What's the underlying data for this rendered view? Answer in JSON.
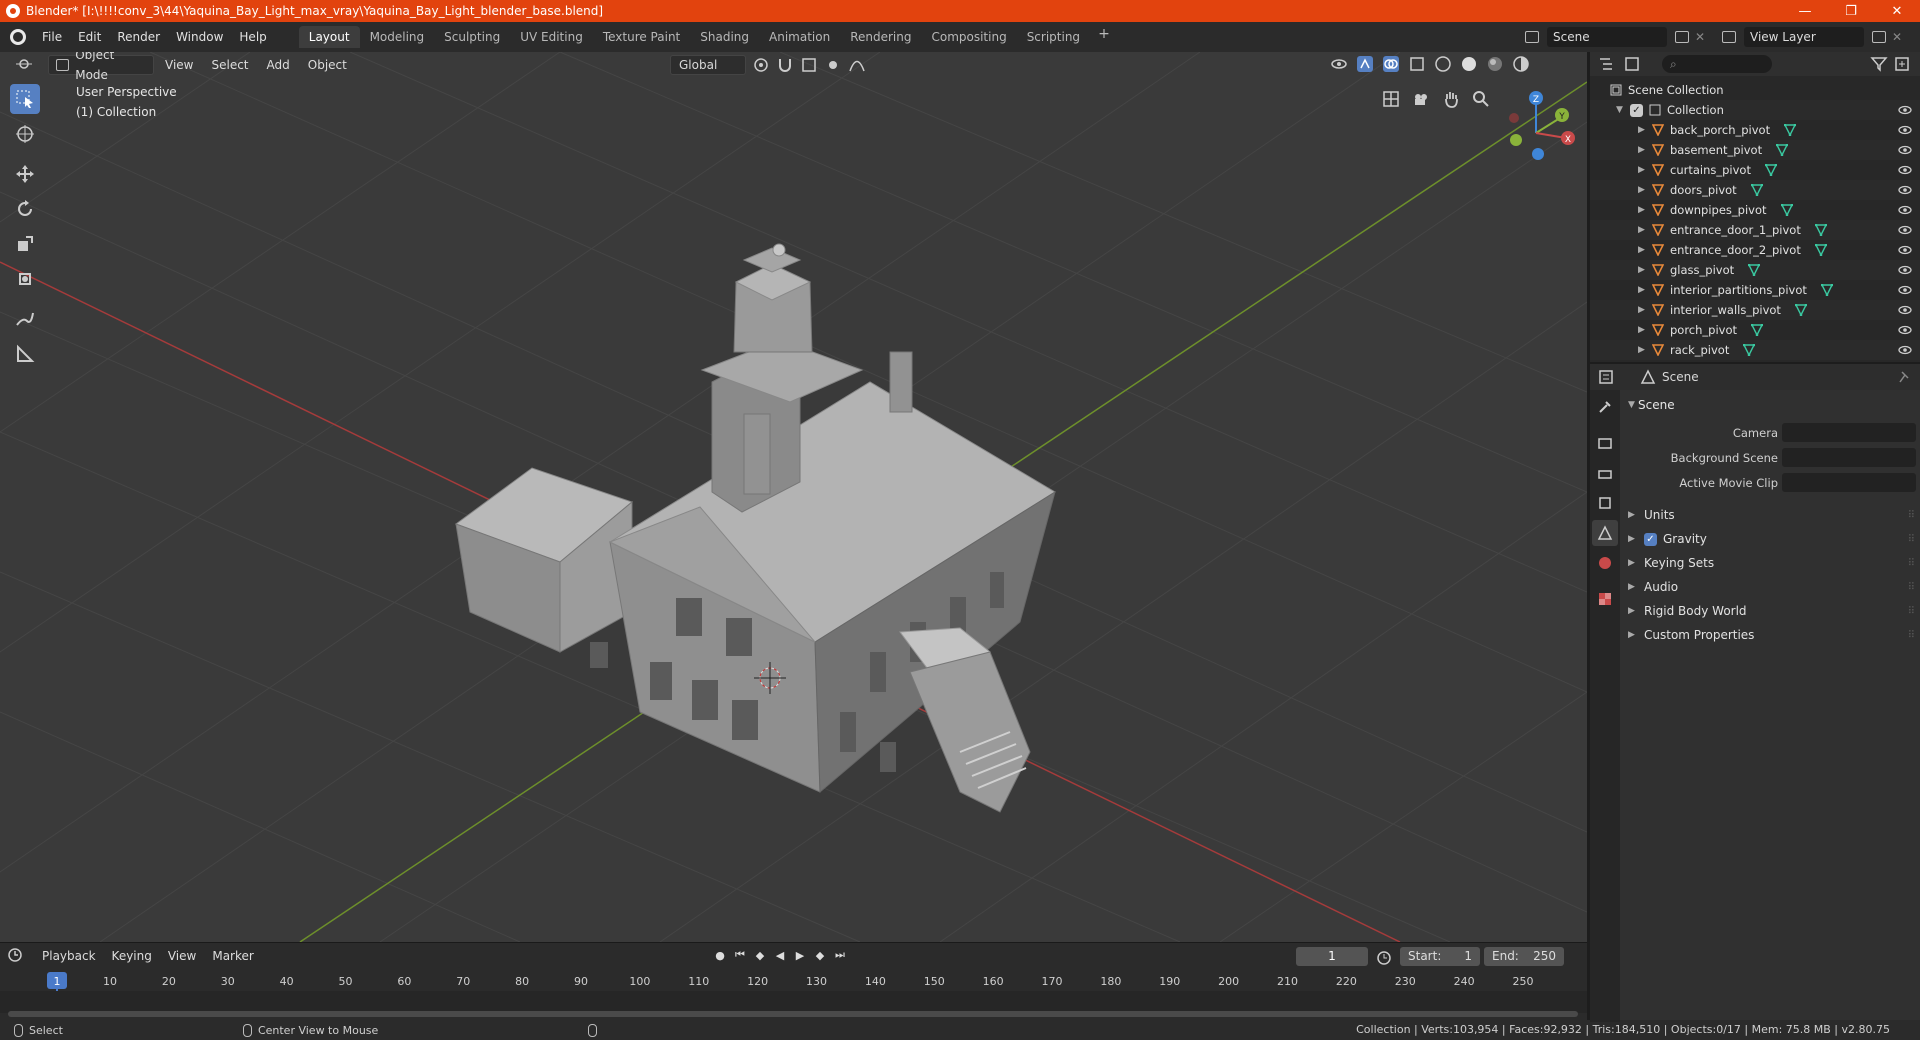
{
  "window": {
    "title": "Blender* [I:\\!!!!conv_3\\44\\Yaquina_Bay_Light_max_vray\\Yaquina_Bay_Light_blender_base.blend]",
    "minimize": "—",
    "maximize": "❐",
    "close": "✕"
  },
  "menu": [
    "File",
    "Edit",
    "Render",
    "Window",
    "Help"
  ],
  "workspaces": [
    "Layout",
    "Modeling",
    "Sculpting",
    "UV Editing",
    "Texture Paint",
    "Shading",
    "Animation",
    "Rendering",
    "Compositing",
    "Scripting"
  ],
  "workspace_add": "+",
  "scene_selector": "Scene",
  "view_layer_selector": "View Layer",
  "viewport": {
    "mode": "Object Mode",
    "menus": [
      "View",
      "Select",
      "Add",
      "Object"
    ],
    "orientation": "Global",
    "overlay_line1": "User Perspective",
    "overlay_line2": "(1) Collection",
    "gizmo": {
      "x": "X",
      "y": "Y",
      "z": "Z"
    }
  },
  "timeline": {
    "menus": [
      "Playback",
      "Keying",
      "View",
      "Marker"
    ],
    "current_frame": "1",
    "start_label": "Start:",
    "start": "1",
    "end_label": "End:",
    "end": "250",
    "ticks": [
      "1",
      "10",
      "20",
      "30",
      "40",
      "50",
      "60",
      "70",
      "80",
      "90",
      "100",
      "110",
      "120",
      "130",
      "140",
      "150",
      "160",
      "170",
      "180",
      "190",
      "200",
      "210",
      "220",
      "230",
      "240",
      "250"
    ]
  },
  "statusbar": {
    "select": "Select",
    "center_view": "Center View to Mouse",
    "stats": "Collection | Verts:103,954 | Faces:92,932 | Tris:184,510 | Objects:0/17 | Mem: 75.8 MB | v2.80.75"
  },
  "outliner": {
    "scene_collection": "Scene Collection",
    "collection": "Collection",
    "items": [
      "back_porch_pivot",
      "basement_pivot",
      "curtains_pivot",
      "doors_pivot",
      "downpipes_pivot",
      "entrance_door_1_pivot",
      "entrance_door_2_pivot",
      "glass_pivot",
      "interior_partitions_pivot",
      "interior_walls_pivot",
      "porch_pivot",
      "rack_pivot"
    ]
  },
  "properties": {
    "header": "Scene",
    "panel": "Scene",
    "fields": [
      {
        "label": "Camera"
      },
      {
        "label": "Background Scene"
      },
      {
        "label": "Active Movie Clip"
      }
    ],
    "subpanels": [
      {
        "label": "Units",
        "checkbox": false
      },
      {
        "label": "Gravity",
        "checkbox": true
      },
      {
        "label": "Keying Sets",
        "checkbox": false
      },
      {
        "label": "Audio",
        "checkbox": false
      },
      {
        "label": "Rigid Body World",
        "checkbox": false
      },
      {
        "label": "Custom Properties",
        "checkbox": false
      }
    ]
  },
  "colors": {
    "titlebar": "#e2430e",
    "accent": "#5680c2",
    "x_axis": "#c94a4a",
    "y_axis": "#8ab33a",
    "z_axis": "#3f86d8",
    "object_orange": "#e8893a",
    "mesh_green": "#3ac8a0"
  }
}
